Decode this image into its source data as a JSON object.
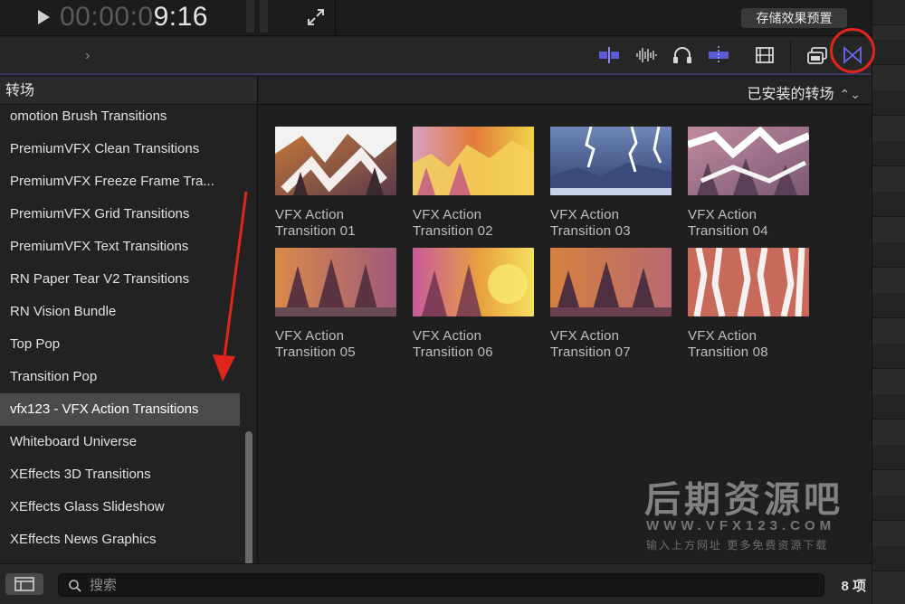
{
  "viewer": {
    "timecode_dim": "00:00:0",
    "timecode_lit": "9:16",
    "save_preset_label": "存储效果预置"
  },
  "toolbar": {
    "icons": [
      "split-audio-icon",
      "waveform-icon",
      "headphones-icon",
      "snapping-icon",
      "film-icon",
      "clip-appearance-icon",
      "transitions-browser-icon"
    ]
  },
  "sidebar": {
    "header": "转场",
    "items": [
      {
        "label": "omotion Brush Transitions"
      },
      {
        "label": "PremiumVFX Clean Transitions"
      },
      {
        "label": "PremiumVFX Freeze Frame Tra..."
      },
      {
        "label": "PremiumVFX Grid Transitions"
      },
      {
        "label": "PremiumVFX Text Transitions"
      },
      {
        "label": "RN Paper Tear V2 Transitions"
      },
      {
        "label": "RN Vision Bundle"
      },
      {
        "label": "Top Pop"
      },
      {
        "label": "Transition Pop"
      },
      {
        "label": "vfx123 - VFX Action Transitions",
        "selected": true
      },
      {
        "label": "Whiteboard Universe"
      },
      {
        "label": "XEffects 3D Transitions"
      },
      {
        "label": "XEffects Glass Slideshow"
      },
      {
        "label": "XEffects News Graphics"
      }
    ]
  },
  "content": {
    "category": "已安装的转场",
    "transitions": [
      {
        "line1": "VFX Action",
        "line2": "Transition 01"
      },
      {
        "line1": "VFX Action",
        "line2": "Transition 02"
      },
      {
        "line1": "VFX Action",
        "line2": "Transition 03"
      },
      {
        "line1": "VFX Action",
        "line2": "Transition 04"
      },
      {
        "line1": "VFX Action",
        "line2": "Transition 05"
      },
      {
        "line1": "VFX Action",
        "line2": "Transition 06"
      },
      {
        "line1": "VFX Action",
        "line2": "Transition 07"
      },
      {
        "line1": "VFX Action",
        "line2": "Transition 08"
      }
    ]
  },
  "watermark": {
    "title": "后期资源吧",
    "url": "WWW.VFX123.COM",
    "subtitle": "输入上方网址 更多免费资源下载"
  },
  "bottom": {
    "search_placeholder": "搜索",
    "item_count": "8 项"
  },
  "colors": {
    "accent": "#5b5bd6",
    "annotation_red": "#e0251c"
  }
}
